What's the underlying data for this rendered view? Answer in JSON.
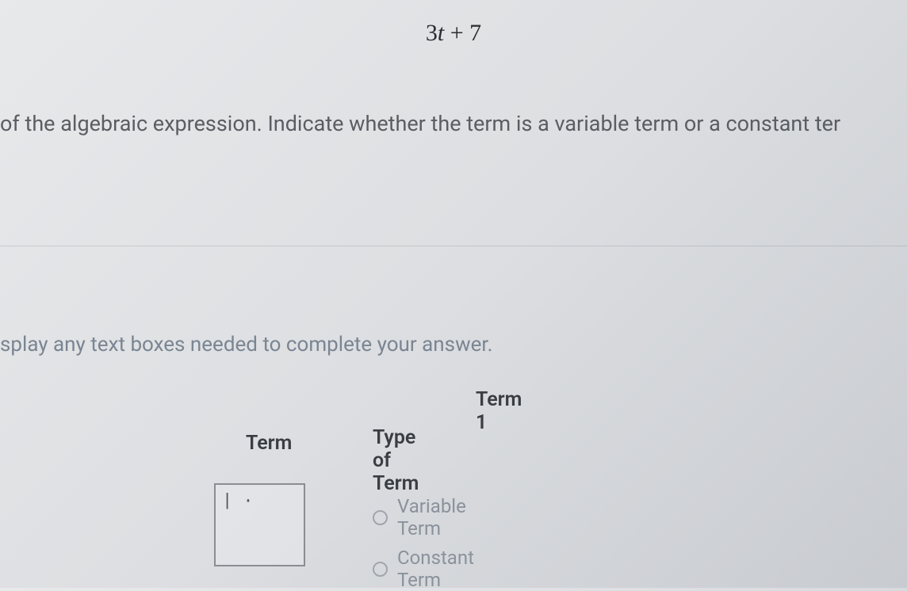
{
  "expression": {
    "coeff": "3",
    "variable": "t",
    "operator": " + ",
    "constant": "7"
  },
  "instruction": " of the algebraic expression. Indicate whether the term is a variable term or a constant ter",
  "hint": "splay any text boxes needed to complete your answer.",
  "section": {
    "title": "Term 1",
    "term_header": "Term",
    "type_header": "Type of Term",
    "input_value": "",
    "cursor_hint": "| ·",
    "options": {
      "variable": "Variable Term",
      "constant": "Constant Term"
    }
  }
}
